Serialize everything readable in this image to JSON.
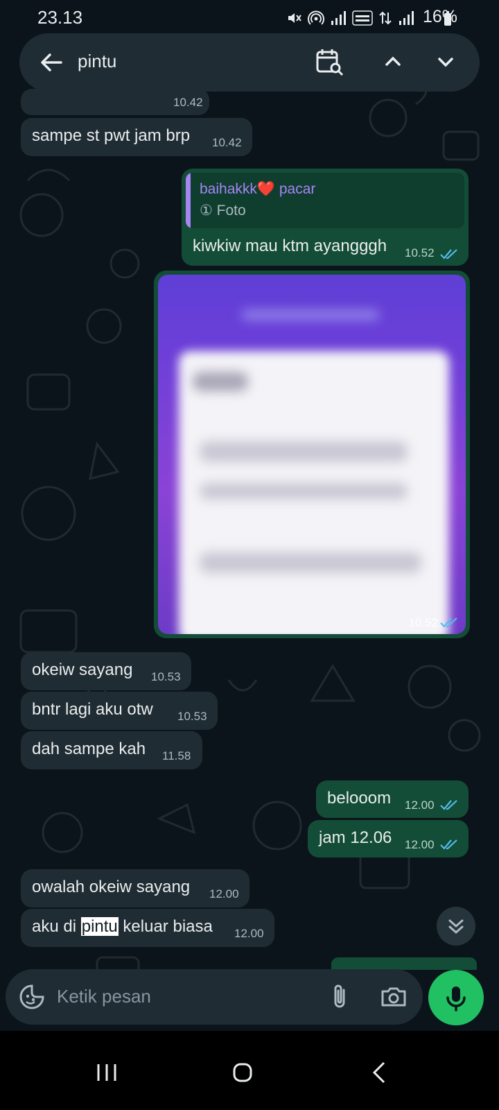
{
  "status": {
    "time": "23.13",
    "battery": "16%"
  },
  "search": {
    "query": "pintu"
  },
  "messages": {
    "m0": {
      "text": "sampe st pwt jam brp",
      "time": "10.42"
    },
    "m1": {
      "reply_name": "baihakkk❤️ pacar",
      "reply_type": "Foto",
      "text": "kiwkiw mau ktm ayangggh",
      "time": "10.52"
    },
    "m2": {
      "time": "10.52"
    },
    "m3": {
      "text": "okeiw sayang",
      "time": "10.53"
    },
    "m4": {
      "text": "bntr lagi aku otw",
      "time": "10.53"
    },
    "m5": {
      "text": "dah sampe kah",
      "time": "11.58"
    },
    "m6": {
      "text": "belooom",
      "time": "12.00"
    },
    "m7": {
      "text": "jam 12.06",
      "time": "12.00"
    },
    "m8": {
      "text": "owalah okeiw sayang",
      "time": "12.00"
    },
    "m9": {
      "pre": "aku di ",
      "hit": "pintu",
      "post": " keluar biasa",
      "time": "12.00"
    },
    "partial_top_time": "10.42"
  },
  "composer": {
    "placeholder": "Ketik pesan"
  },
  "colors": {
    "accent": "#21c063",
    "outgoing": "#144d37",
    "incoming": "#202c33",
    "tick_read": "#53bdeb"
  },
  "icons": [
    "back-arrow-icon",
    "calendar-search-icon",
    "chevron-up-icon",
    "chevron-down-icon",
    "emoji-sticker-icon",
    "paperclip-icon",
    "camera-icon",
    "microphone-icon",
    "double-chevron-down-icon",
    "recent-apps-icon",
    "home-icon",
    "back-icon"
  ]
}
